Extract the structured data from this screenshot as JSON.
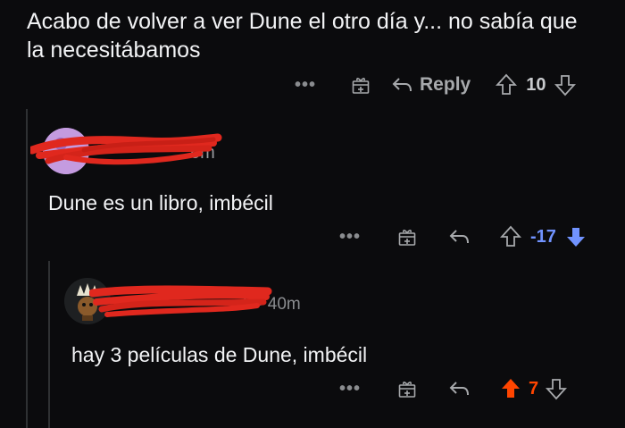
{
  "post": {
    "text": "Acabo de volver a ver Dune el otro día y... no sabía que la necesitábamos",
    "actions": {
      "more": "•••",
      "reply_label": "Reply",
      "score": "10"
    }
  },
  "comment1": {
    "meta_fragment": "5m",
    "text": "Dune es un libro, imbécil",
    "actions": {
      "more": "•••",
      "score": "-17",
      "vote_state": "downvoted"
    }
  },
  "comment2": {
    "meta_fragment": "5 • 40m",
    "text": "hay 3 películas de Dune, imbécil",
    "actions": {
      "more": "•••",
      "score": "7",
      "vote_state": "upvoted"
    }
  },
  "colors": {
    "background": "#0b0b0d",
    "upvote": "#ff4500",
    "downvote": "#7193ff",
    "redaction": "#e0281e"
  }
}
